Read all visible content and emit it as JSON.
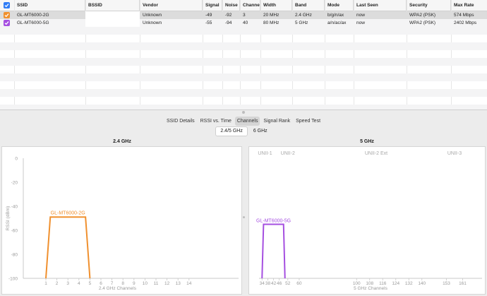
{
  "table": {
    "columns": [
      "SSID",
      "BSSID",
      "Vendor",
      "Signal",
      "Noise",
      "Channel",
      "Width",
      "Band",
      "Mode",
      "Last Seen",
      "Security",
      "Max Rate"
    ],
    "rows": [
      {
        "color": "#f0902e",
        "ssid": "GL-MT6000-2G",
        "bssid": "",
        "vendor": "Unknown",
        "signal": "-49",
        "noise": "-92",
        "channel": "3",
        "width": "20 MHz",
        "band": "2.4 GHz",
        "mode": "b/g/n/ax",
        "last_seen": "now",
        "security": "WPA2 (PSK)",
        "max_rate": "574 Mbps"
      },
      {
        "color": "#a54fe0",
        "ssid": "GL-MT6000-5G",
        "bssid": "",
        "vendor": "Unknown",
        "signal": "-55",
        "noise": "-94",
        "channel": "40",
        "width": "80 MHz",
        "band": "5 GHz",
        "mode": "a/n/ac/ax",
        "last_seen": "now",
        "security": "WPA2 (PSK)",
        "max_rate": "2402 Mbps"
      }
    ]
  },
  "tabs": [
    "SSID Details",
    "RSSI vs. Time",
    "Channels",
    "Signal Rank",
    "Speed Test"
  ],
  "active_tab": "Channels",
  "subtabs": [
    "2.4/5 GHz",
    "6 GHz"
  ],
  "active_subtab": "2.4/5 GHz",
  "panels": {
    "left_title": "2.4 GHz",
    "right_title": "5 GHz"
  },
  "chart_data": [
    {
      "type": "area",
      "title": "2.4 GHz",
      "xlabel": "2.4 GHz Channels",
      "ylabel": "RSSI (dBm)",
      "ylim": [
        -100,
        0
      ],
      "yticks": [
        "0",
        "-20",
        "-40",
        "-60",
        "-80",
        "-100"
      ],
      "xticks": [
        "1",
        "2",
        "3",
        "4",
        "5",
        "6",
        "7",
        "8",
        "9",
        "10",
        "11",
        "12",
        "13",
        "14"
      ],
      "grid": false,
      "series": [
        {
          "name": "GL-MT6000-2G",
          "color": "#f0902e",
          "center_channel": 3,
          "width_channels": 4,
          "rssi": -49
        }
      ]
    },
    {
      "type": "area",
      "title": "5 GHz",
      "xlabel": "5 GHz Channels",
      "ylim": [
        -100,
        0
      ],
      "xticks": [
        "34",
        "38",
        "42",
        "46",
        "52",
        "60",
        "100",
        "108",
        "116",
        "124",
        "132",
        "140",
        "153",
        "161"
      ],
      "band_labels": [
        "UNII-1",
        "UNII-2",
        "UNII-2 Ext",
        "UNII-3"
      ],
      "grid": false,
      "series": [
        {
          "name": "GL-MT6000-5G",
          "color": "#a54fe0",
          "center_channel": 42,
          "width_channels": 16,
          "rssi": -55
        }
      ]
    }
  ]
}
